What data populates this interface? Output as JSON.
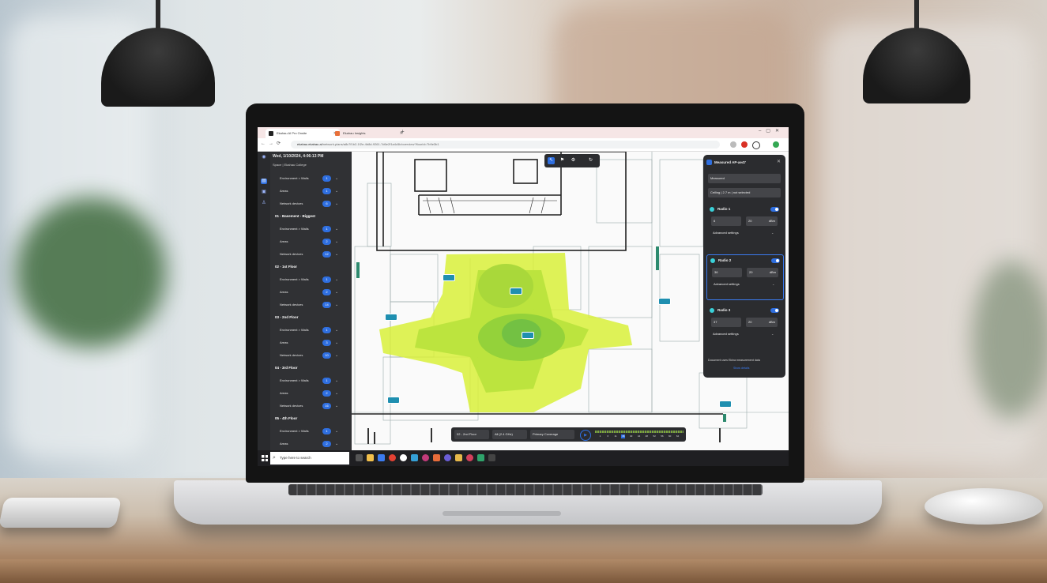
{
  "browser": {
    "tabs": [
      {
        "label": "Ekahau AI Pro Onsite"
      },
      {
        "label": "Ekahau Insights"
      }
    ],
    "url_host": "ekahau.ekahau.ai",
    "url_path": "/network-plans/a8c7f1b2-1f2e-4b8d-9261-7d6e2f1a4c5b/overview?floorId=7b9e3b1"
  },
  "sidebar": {
    "date": "Wed, 1/10/2024, 4:06:13 PM",
    "site": "Space | Ekahau College",
    "rows": [
      {
        "label": "Environment > Walls",
        "badge": "1",
        "kind": "item"
      },
      {
        "label": "Areas",
        "badge": "1",
        "kind": "item"
      },
      {
        "label": "Network devices",
        "badge": "6",
        "kind": "item"
      },
      {
        "label": "01 - Basement - Biggest",
        "badge": "",
        "kind": "header"
      },
      {
        "label": "Environment > Walls",
        "badge": "1",
        "kind": "item"
      },
      {
        "label": "Areas",
        "badge": "2",
        "kind": "item"
      },
      {
        "label": "Network devices",
        "badge": "12",
        "kind": "item"
      },
      {
        "label": "02 - 1st Floor",
        "badge": "",
        "kind": "header"
      },
      {
        "label": "Environment > Walls",
        "badge": "1",
        "kind": "item"
      },
      {
        "label": "Areas",
        "badge": "2",
        "kind": "item"
      },
      {
        "label": "Network devices",
        "badge": "14",
        "kind": "item"
      },
      {
        "label": "03 - 2nd Floor",
        "badge": "",
        "kind": "header"
      },
      {
        "label": "Environment > Walls",
        "badge": "1",
        "kind": "item"
      },
      {
        "label": "Areas",
        "badge": "3",
        "kind": "item"
      },
      {
        "label": "Network devices",
        "badge": "10",
        "kind": "item"
      },
      {
        "label": "04 - 3rd Floor",
        "badge": "",
        "kind": "header"
      },
      {
        "label": "Environment > Walls",
        "badge": "1",
        "kind": "item"
      },
      {
        "label": "Areas",
        "badge": "2",
        "kind": "item"
      },
      {
        "label": "Network devices",
        "badge": "16",
        "kind": "item"
      },
      {
        "label": "05 - 4th Floor",
        "badge": "",
        "kind": "header"
      },
      {
        "label": "Environment > Walls",
        "badge": "1",
        "kind": "item"
      },
      {
        "label": "Areas",
        "badge": "2",
        "kind": "item"
      }
    ]
  },
  "panel": {
    "title": "Measured AP-ae47",
    "vendor": "Measured",
    "mounting_caption": "Mounting",
    "mounting": "Ceiling | 2.7 m | not selected",
    "radios": [
      {
        "name": "Radio 1",
        "channel": "6",
        "power": "20",
        "unit": "dBm"
      },
      {
        "name": "Radio 2",
        "channel": "36",
        "power": "20",
        "unit": "dBm"
      },
      {
        "name": "Radio 3",
        "channel": "37",
        "power": "20",
        "unit": "dBm"
      }
    ],
    "advanced": "Advanced settings",
    "note": "Document uses Ekina measurement data",
    "link": "Show details"
  },
  "bottom": {
    "floor_caption": "Floor",
    "floor": "02 - 2nd Floor",
    "band_caption": "Band",
    "band": "All (2.4 GHz)",
    "view_caption": "Visualization",
    "view": "Primary Coverage",
    "channels": [
      "1",
      "6",
      "11",
      "36",
      "40",
      "44",
      "48",
      "52",
      "56",
      "60",
      "64"
    ],
    "selected_channel": "36"
  },
  "taskbar": {
    "search_placeholder": "Type here to search"
  },
  "colors": {
    "accent": "#2f6fe0",
    "heatmap_outer": "#d8f03a",
    "heatmap_inner": "#8fcf3a",
    "sidebar_bg": "#303134"
  }
}
